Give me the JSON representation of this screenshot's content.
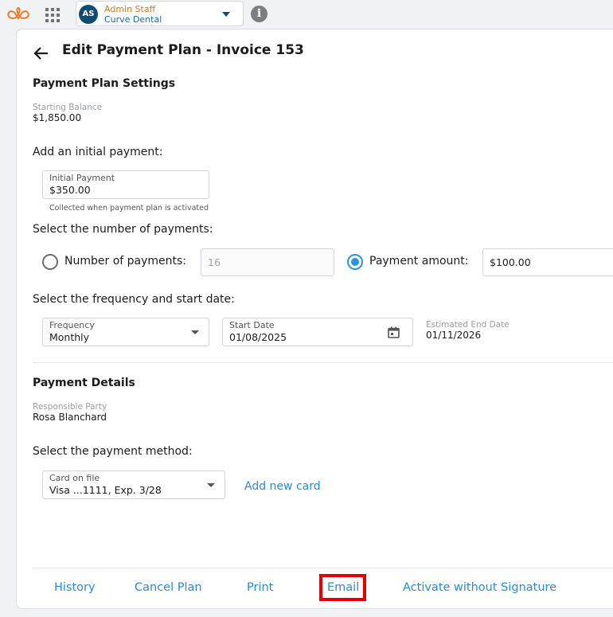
{
  "topbar": {
    "user": {
      "initials": "AS",
      "name": "Admin Staff",
      "org": "Curve Dental"
    },
    "info_glyph": "i",
    "icons": [
      "curve-logo-icon",
      "apps-grid-icon",
      "chevron-down-icon",
      "info-icon"
    ]
  },
  "page": {
    "title": "Edit Payment Plan - Invoice 153",
    "settings_heading": "Payment Plan Settings",
    "starting_balance_label": "Starting Balance",
    "starting_balance": "$1,850.00",
    "initial_payment_prompt": "Add an initial payment:",
    "initial_payment_label": "Initial Payment",
    "initial_payment_value": "$350.00",
    "initial_payment_hint": "Collected when payment plan is activated",
    "num_payments_prompt": "Select the number of payments:",
    "radio_num_label": "Number of payments:",
    "radio_num_value": "16",
    "radio_amount_label": "Payment amount:",
    "radio_amount_value": "$100.00",
    "selected_option": "Payment amount",
    "frequency_prompt": "Select the frequency and start date:",
    "frequency_label": "Frequency",
    "frequency_value": "Monthly",
    "start_date_label": "Start Date",
    "start_date_value": "01/08/2025",
    "end_date_label": "Estimated End Date",
    "end_date_value": "01/11/2026",
    "details_heading": "Payment Details",
    "responsible_label": "Responsible Party",
    "responsible_value": "Rosa Blanchard",
    "method_prompt": "Select the payment method:",
    "card_label": "Card on file",
    "card_value": "Visa ...1111, Exp. 3/28",
    "add_card": "Add new card"
  },
  "footer": {
    "history": "History",
    "cancel": "Cancel Plan",
    "print": "Print",
    "email": "Email",
    "activate": "Activate without Signature"
  },
  "colors": {
    "accent": "#2a8ad4",
    "highlight": "#e30000",
    "brand_orange": "#e0751c"
  }
}
